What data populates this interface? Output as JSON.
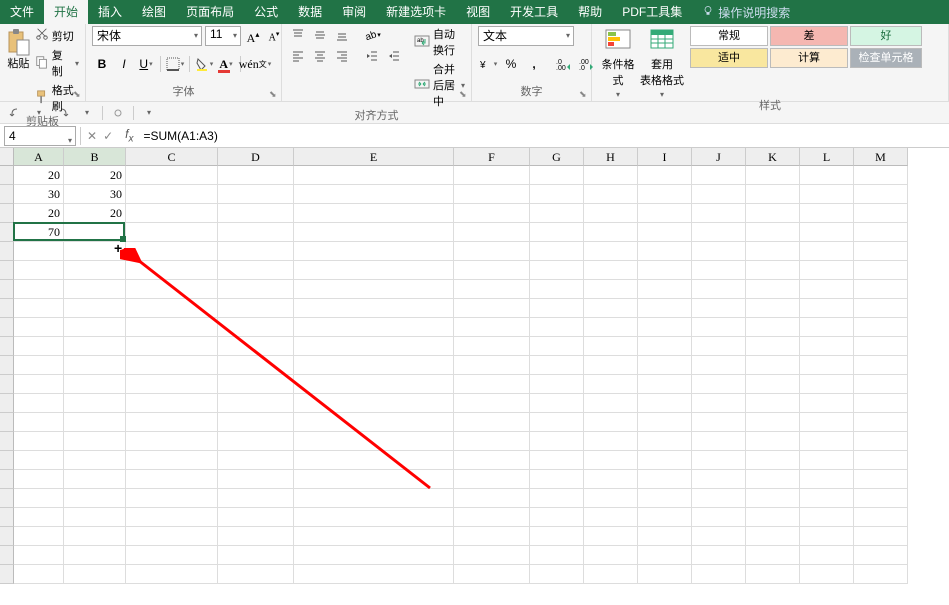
{
  "tabs": {
    "file": "文件",
    "home": "开始",
    "insert": "插入",
    "draw": "绘图",
    "layout": "页面布局",
    "formulas": "公式",
    "data": "数据",
    "review": "审阅",
    "newtab": "新建选项卡",
    "view": "视图",
    "dev": "开发工具",
    "help": "帮助",
    "pdf": "PDF工具集",
    "tellme": "操作说明搜索"
  },
  "clipboard": {
    "paste": "粘贴",
    "cut": "剪切",
    "copy": "复制",
    "format_painter": "格式刷",
    "group": "剪贴板"
  },
  "font": {
    "name": "宋体",
    "size": "11",
    "group": "字体",
    "bold": "B",
    "italic": "I",
    "underline": "U"
  },
  "align": {
    "group": "对齐方式",
    "wrap": "自动换行",
    "merge": "合并后居中"
  },
  "number": {
    "group": "数字",
    "format": "文本"
  },
  "styles": {
    "cond": "条件格式",
    "table": "套用\n表格格式",
    "group": "样式",
    "normal": "常规",
    "note": "适中",
    "bad": "差",
    "calc": "计算",
    "good": "好",
    "check": "检查单元格"
  },
  "namebox": "4",
  "formula": "=SUM(A1:A3)",
  "columns": [
    "A",
    "B",
    "C",
    "D",
    "E",
    "F",
    "G",
    "H",
    "I",
    "J",
    "K",
    "L",
    "M"
  ],
  "cells": {
    "A1": "20",
    "B1": "20",
    "A2": "30",
    "B2": "30",
    "A3": "20",
    "B3": "20",
    "A4": "70"
  }
}
